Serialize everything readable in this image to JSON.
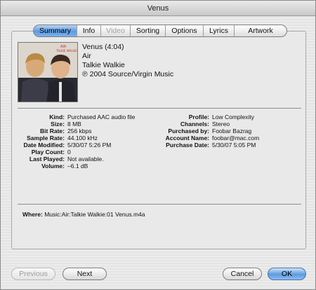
{
  "window": {
    "title": "Venus"
  },
  "tabs": [
    {
      "label": "Summary",
      "state": "active"
    },
    {
      "label": "Info",
      "state": "normal"
    },
    {
      "label": "Video",
      "state": "disabled"
    },
    {
      "label": "Sorting",
      "state": "normal"
    },
    {
      "label": "Options",
      "state": "normal"
    },
    {
      "label": "Lyrics",
      "state": "normal"
    },
    {
      "label": "Artwork",
      "state": "normal"
    }
  ],
  "album_art": {
    "caption_line1": "AIR",
    "caption_line2": "TALKIE WALKIE"
  },
  "song": {
    "title_line": "Venus (4:04)",
    "artist": "Air",
    "album": "Talkie Walkie",
    "copyright": "℗ 2004 Source/Virgin Music"
  },
  "details_left": [
    {
      "key": "Kind:",
      "value": "Purchased AAC audio file"
    },
    {
      "key": "Size:",
      "value": "8 MB"
    },
    {
      "key": "Bit Rate:",
      "value": "256 kbps"
    },
    {
      "key": "Sample Rate:",
      "value": "44.100 kHz"
    },
    {
      "key": "Date Modified:",
      "value": "5/30/07 5:26 PM"
    },
    {
      "key": "Play Count:",
      "value": "0"
    },
    {
      "key": "Last Played:",
      "value": "Not available."
    },
    {
      "key": "Volume:",
      "value": "–6.1 dB"
    }
  ],
  "details_right": [
    {
      "key": "Profile:",
      "value": "Low Complexity"
    },
    {
      "key": "Channels:",
      "value": "Stereo"
    },
    {
      "key": "Purchased by:",
      "value": "Foobar Bazrag"
    },
    {
      "key": "Account Name:",
      "value": "foobar@mac.com"
    },
    {
      "key": "Purchase Date:",
      "value": "5/30/07 5:05 PM"
    }
  ],
  "where": {
    "key": "Where:",
    "value": "Music:Air:Talkie Walkie:01 Venus.m4a"
  },
  "buttons": {
    "previous": "Previous",
    "next": "Next",
    "cancel": "Cancel",
    "ok": "OK"
  }
}
